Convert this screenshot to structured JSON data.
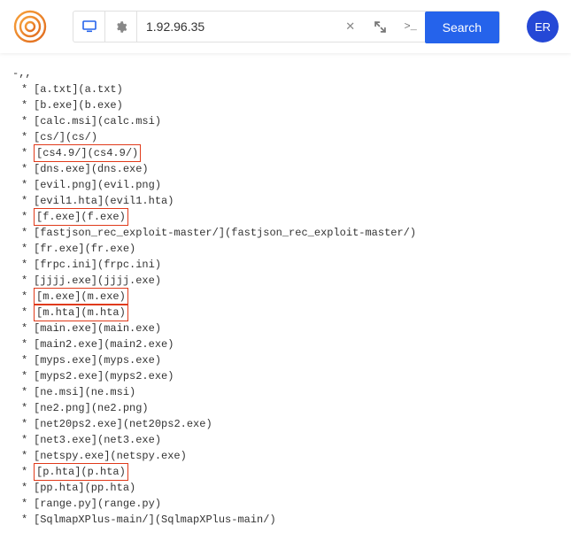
{
  "header": {
    "logo_label": "logo",
    "screen_icon": "screen",
    "gear_icon": "settings",
    "address_value": "1.92.96.35",
    "clear_icon": "clear",
    "expand_icon": "expand",
    "terminal_icon": "terminal",
    "search_label": "Search",
    "avatar_initials": "ER"
  },
  "listing_prefix_line": "-,,",
  "entries": [
    {
      "name": "a.txt",
      "link": "a.txt",
      "hl": false
    },
    {
      "name": "b.exe",
      "link": "b.exe",
      "hl": false
    },
    {
      "name": "calc.msi",
      "link": "calc.msi",
      "hl": false
    },
    {
      "name": "cs/",
      "link": "cs/",
      "hl": false
    },
    {
      "name": "cs4.9/",
      "link": "cs4.9/",
      "hl": true
    },
    {
      "name": "dns.exe",
      "link": "dns.exe",
      "hl": false
    },
    {
      "name": "evil.png",
      "link": "evil.png",
      "hl": false
    },
    {
      "name": "evil1.hta",
      "link": "evil1.hta",
      "hl": false
    },
    {
      "name": "f.exe",
      "link": "f.exe",
      "hl": true
    },
    {
      "name": "fastjson_rec_exploit-master/",
      "link": "fastjson_rec_exploit-master/",
      "hl": false
    },
    {
      "name": "fr.exe",
      "link": "fr.exe",
      "hl": false
    },
    {
      "name": "frpc.ini",
      "link": "frpc.ini",
      "hl": false
    },
    {
      "name": "jjjj.exe",
      "link": "jjjj.exe",
      "hl": false
    },
    {
      "name": "m.exe",
      "link": "m.exe",
      "hl": true
    },
    {
      "name": "m.hta",
      "link": "m.hta",
      "hl": true
    },
    {
      "name": "main.exe",
      "link": "main.exe",
      "hl": false
    },
    {
      "name": "main2.exe",
      "link": "main2.exe",
      "hl": false
    },
    {
      "name": "myps.exe",
      "link": "myps.exe",
      "hl": false
    },
    {
      "name": "myps2.exe",
      "link": "myps2.exe",
      "hl": false
    },
    {
      "name": "ne.msi",
      "link": "ne.msi",
      "hl": false
    },
    {
      "name": "ne2.png",
      "link": "ne2.png",
      "hl": false
    },
    {
      "name": "net20ps2.exe",
      "link": "net20ps2.exe",
      "hl": false
    },
    {
      "name": "net3.exe",
      "link": "net3.exe",
      "hl": false
    },
    {
      "name": "netspy.exe",
      "link": "netspy.exe",
      "hl": false
    },
    {
      "name": "p.hta",
      "link": "p.hta",
      "hl": true
    },
    {
      "name": "pp.hta",
      "link": "pp.hta",
      "hl": false
    },
    {
      "name": "range.py",
      "link": "range.py",
      "hl": false
    },
    {
      "name": "SqlmapXPlus-main/",
      "link": "SqlmapXPlus-main/",
      "hl": false
    }
  ]
}
